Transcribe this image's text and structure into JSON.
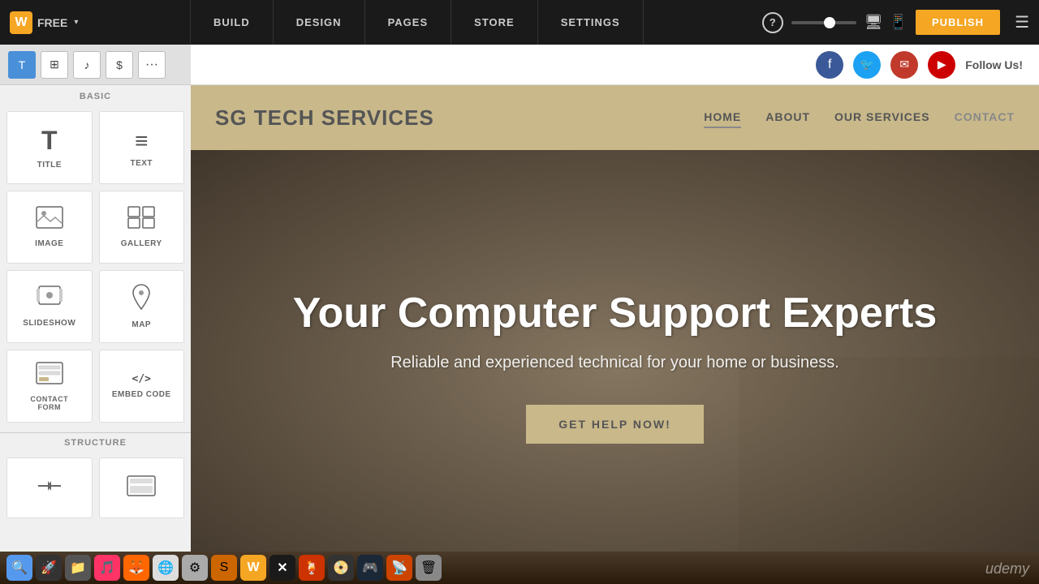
{
  "topbar": {
    "logo": "W",
    "plan": "FREE",
    "nav": [
      "BUILD",
      "DESIGN",
      "PAGES",
      "STORE",
      "SETTINGS"
    ],
    "help": "?",
    "publish_label": "PUBLISH"
  },
  "sidebar": {
    "section_basic": "BASIC",
    "section_structure": "STRUCTURE",
    "tools": [
      "T",
      "⊞",
      "♪",
      "$",
      "···"
    ],
    "widgets": [
      {
        "id": "title",
        "label": "TITLE",
        "icon": "T"
      },
      {
        "id": "text",
        "label": "TEXT",
        "icon": "≡"
      },
      {
        "id": "image",
        "label": "IMAGE",
        "icon": "🖼"
      },
      {
        "id": "gallery",
        "label": "GALLERY",
        "icon": "⊞"
      },
      {
        "id": "slideshow",
        "label": "SLIDESHOW",
        "icon": "▤"
      },
      {
        "id": "map",
        "label": "MAP",
        "icon": "📍"
      },
      {
        "id": "contact-form",
        "label": "CONTACT FORM",
        "icon": "▦"
      },
      {
        "id": "embed",
        "label": "EMBED CODE",
        "icon": "</>"
      }
    ],
    "structure_items": [
      {
        "id": "divider",
        "label": "",
        "icon": "⊟"
      },
      {
        "id": "section",
        "label": "",
        "icon": "⬚"
      }
    ]
  },
  "social_bar": {
    "icons": [
      "f",
      "t",
      "✉",
      "▶"
    ],
    "follow_text": "Follow Us!"
  },
  "site": {
    "logo": "SG TECH SERVICES",
    "nav": [
      "HOME",
      "ABOUT",
      "OUR SERVICES",
      "CONTACT"
    ],
    "active_nav": "HOME",
    "hero_title": "Your Computer Support Experts",
    "hero_subtitle": "Reliable and experienced technical for your home or business.",
    "cta_label": "GET HELP NOW!"
  },
  "taskbar": {
    "udemy": "udemy"
  }
}
